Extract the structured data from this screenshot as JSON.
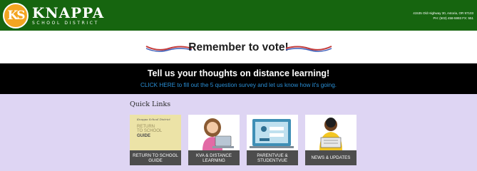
{
  "header": {
    "logo_mark": "KS",
    "logo_name": "KNAPPA",
    "logo_sub": "SCHOOL DISTRICT",
    "address_line": "41535 Old Highway 30, Astoria, OR 97103",
    "phone_line": "PH: (503) 458-5993 FX: 551"
  },
  "vote_banner": {
    "text": "Remember to vote!"
  },
  "survey": {
    "title": "Tell us your thoughts on distance learning!",
    "link_text": "CLICK HERE to fill out the 5 question survey and let us know how it's going."
  },
  "quick_links": {
    "heading": "Quick Links",
    "guide_image": {
      "script_line": "Knappa School District",
      "line1": "RETURN",
      "line2": "TO SCHOOL",
      "line3": "GUIDE"
    },
    "tiles": [
      {
        "label": "RETURN TO SCHOOL GUIDE",
        "icon": "return-to-school-guide-image"
      },
      {
        "label": "KVA & DISTANCE LEARNING",
        "icon": "student-laptop-illustration"
      },
      {
        "label": "PARENTVUE & STUDENTVUE",
        "icon": "login-screen-illustration"
      },
      {
        "label": "NEWS & UPDATES",
        "icon": "reading-newspaper-illustration"
      }
    ]
  },
  "colors": {
    "header_green": "#16650f",
    "logo_orange": "#f3a521",
    "survey_black": "#000000",
    "link_blue": "#2a8fd6",
    "quick_links_bg": "#ded5f3",
    "tile_label_bg": "#4d4d4d"
  }
}
